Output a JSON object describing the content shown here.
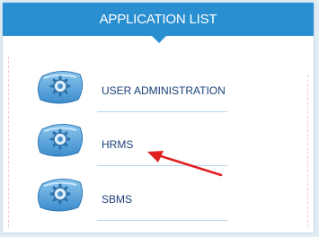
{
  "header": {
    "title": "APPLICATION LIST"
  },
  "apps": [
    {
      "label": "USER ADMINISTRATION",
      "icon": "gear-icon"
    },
    {
      "label": "HRMS",
      "icon": "gear-icon"
    },
    {
      "label": "SBMS",
      "icon": "gear-icon"
    }
  ],
  "colors": {
    "header_bg": "#2a8fd0",
    "label": "#1b3f7a",
    "icon_fill": "#5ea9dd",
    "annotation_arrow": "#e02020"
  }
}
